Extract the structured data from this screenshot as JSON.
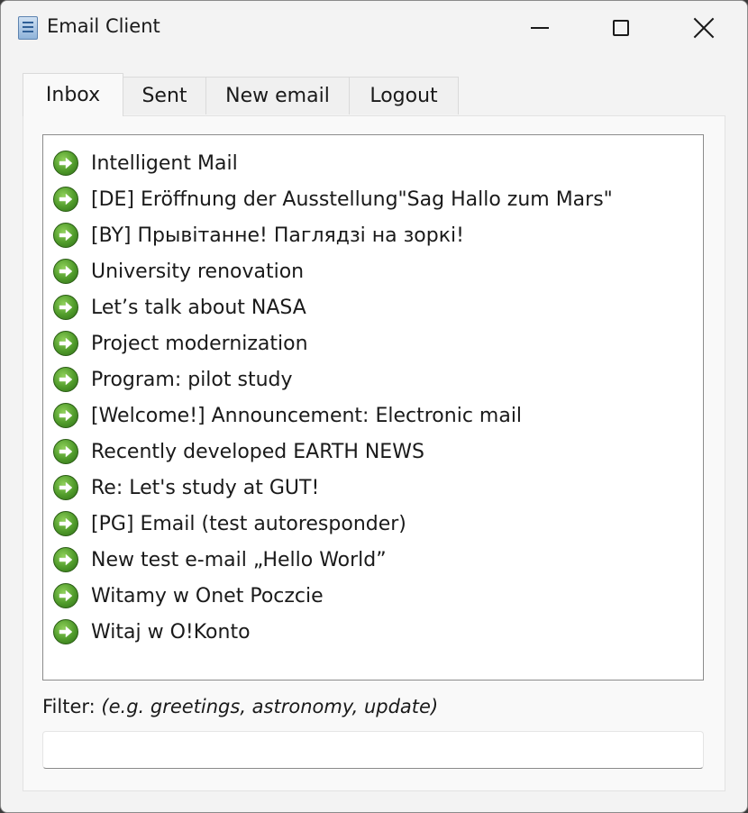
{
  "window": {
    "title": "Email Client"
  },
  "icons": {
    "app": "document-icon",
    "minimize": "minimize-icon",
    "maximize": "maximize-icon",
    "close": "close-icon",
    "mail_item": "green-arrow-right-icon"
  },
  "tabs": [
    {
      "label": "Inbox",
      "active": true
    },
    {
      "label": "Sent",
      "active": false
    },
    {
      "label": "New email",
      "active": false
    },
    {
      "label": "Logout",
      "active": false
    }
  ],
  "inbox": {
    "items": [
      "Intelligent Mail",
      "[DE] Eröffnung der Ausstellung\"Sag Hallo zum Mars\"",
      "[BY] Прывітанне! Паглядзі на зоркі!",
      "University renovation",
      "Let’s talk about NASA",
      "Project modernization",
      "Program: pilot study",
      "[Welcome!] Announcement: Electronic mail",
      "Recently developed EARTH NEWS",
      "Re: Let's study at GUT!",
      "[PG] Email (test autoresponder)",
      "New test e-mail „Hello World”",
      "Witamy w Onet Poczcie",
      "Witaj w O!Konto"
    ]
  },
  "filter": {
    "label": "Filter:",
    "hint": "(e.g. greetings, astronomy, update)",
    "value": "",
    "placeholder": ""
  },
  "colors": {
    "window_bg": "#f3f3f3",
    "panel_bg": "#f9f9f9",
    "icon_green": "#4f9a2a"
  }
}
